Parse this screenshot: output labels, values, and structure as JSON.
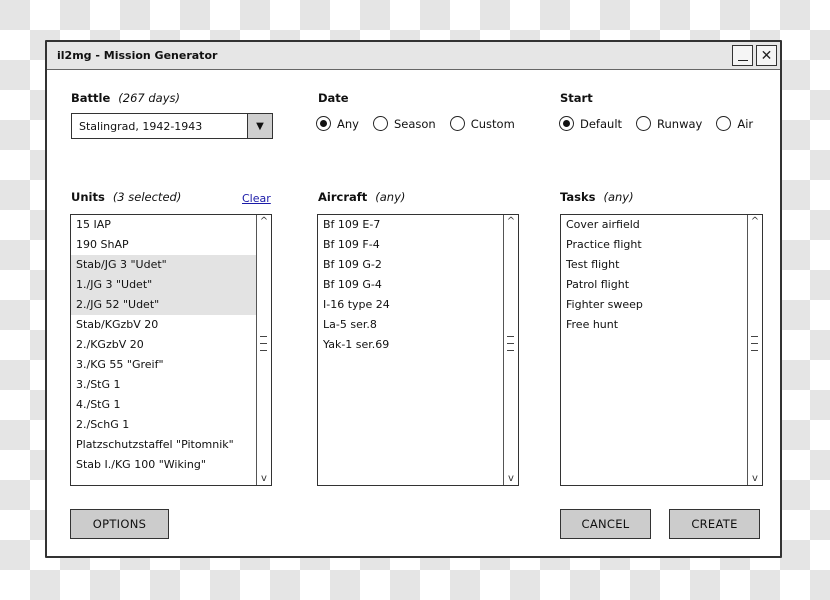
{
  "window": {
    "title": "il2mg - Mission Generator",
    "minimize_label": "_",
    "close_label": "✕"
  },
  "battle": {
    "label": "Battle",
    "hint": "(267 days)",
    "selected": "Stalingrad, 1942-1943",
    "dropdown_icon": "▼"
  },
  "date": {
    "label": "Date",
    "options": [
      {
        "label": "Any",
        "checked": true
      },
      {
        "label": "Season",
        "checked": false
      },
      {
        "label": "Custom",
        "checked": false
      }
    ]
  },
  "start": {
    "label": "Start",
    "options": [
      {
        "label": "Default",
        "checked": true
      },
      {
        "label": "Runway",
        "checked": false
      },
      {
        "label": "Air",
        "checked": false
      }
    ]
  },
  "units": {
    "label": "Units",
    "hint": "(3 selected)",
    "clear_label": "Clear",
    "items": [
      {
        "label": "15 IAP",
        "selected": false
      },
      {
        "label": "190 ShAP",
        "selected": false
      },
      {
        "label": "Stab/JG 3 \"Udet\"",
        "selected": true
      },
      {
        "label": "1./JG 3 \"Udet\"",
        "selected": true
      },
      {
        "label": "2./JG 52 \"Udet\"",
        "selected": true
      },
      {
        "label": "Stab/KGzbV 20",
        "selected": false
      },
      {
        "label": "2./KGzbV 20",
        "selected": false
      },
      {
        "label": "3./KG 55 \"Greif\"",
        "selected": false
      },
      {
        "label": "3./StG 1",
        "selected": false
      },
      {
        "label": "4./StG 1",
        "selected": false
      },
      {
        "label": "2./SchG 1",
        "selected": false
      },
      {
        "label": "Platzschutzstaffel \"Pitomnik\"",
        "selected": false
      },
      {
        "label": "Stab I./KG 100 \"Wiking\"",
        "selected": false
      }
    ]
  },
  "aircraft": {
    "label": "Aircraft",
    "hint": "(any)",
    "items": [
      "Bf 109 E-7",
      "Bf 109 F-4",
      "Bf 109 G-2",
      "Bf 109 G-4",
      "I-16 type 24",
      "La-5 ser.8",
      "Yak-1 ser.69"
    ]
  },
  "tasks": {
    "label": "Tasks",
    "hint": "(any)",
    "items": [
      "Cover airfield",
      "Practice flight",
      "Test flight",
      "Patrol flight",
      "Fighter sweep",
      "Free hunt"
    ]
  },
  "scrollbar": {
    "up_icon": "^",
    "down_icon": "v"
  },
  "buttons": {
    "options": "OPTIONS",
    "cancel": "CANCEL",
    "create": "CREATE"
  }
}
